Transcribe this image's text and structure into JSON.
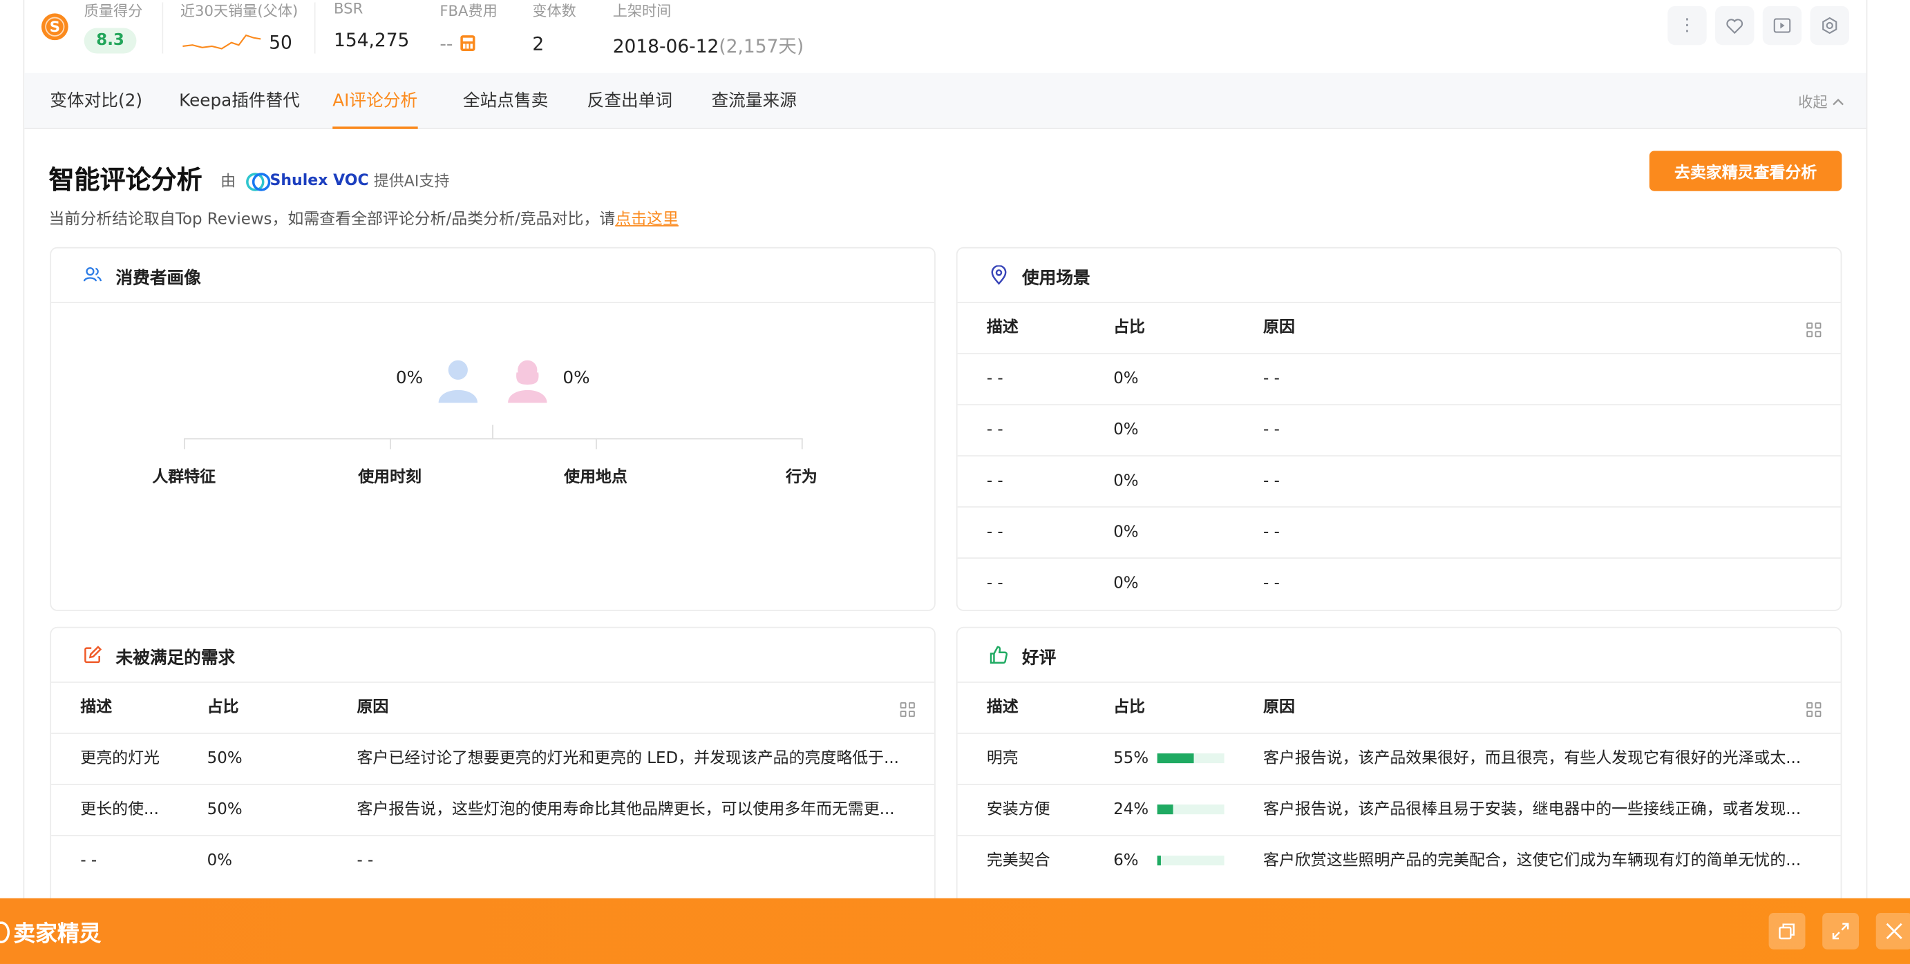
{
  "stats": {
    "quality_label": "质量得分",
    "quality_value": "8.3",
    "sales_label": "近30天销量(父体)",
    "sales_value": "50",
    "bsr_label": "BSR",
    "bsr_value": "154,275",
    "fba_label": "FBA费用",
    "fba_value": "--",
    "variants_label": "变体数",
    "variants_value": "2",
    "listed_label": "上架时间",
    "listed_date": "2018-06-12",
    "listed_days": "(2,157天)"
  },
  "toolbar_icons": [
    "more-vertical-icon",
    "heart-icon",
    "play-icon",
    "gear-icon"
  ],
  "tabs": [
    {
      "label": "变体对比(2)"
    },
    {
      "label": "Keepa插件替代"
    },
    {
      "label": "AI评论分析"
    },
    {
      "label": "全站点售卖"
    },
    {
      "label": "反查出单词"
    },
    {
      "label": "查流量来源"
    }
  ],
  "collapse_label": "收起",
  "header": {
    "title": "智能评论分析",
    "by": "由",
    "provider": "Shulex VOC",
    "support": "提供AI支持",
    "subtitle": "当前分析结论取自Top Reviews，如需查看全部评论分析/品类分析/竞品对比，请",
    "subtitle_link": "点击这里",
    "cta": "去卖家精灵查看分析"
  },
  "consumer": {
    "title": "消费者画像",
    "male_pct": "0%",
    "female_pct": "0%",
    "branches": [
      "人群特征",
      "使用时刻",
      "使用地点",
      "行为"
    ]
  },
  "scenarios": {
    "title": "使用场景",
    "columns": [
      "描述",
      "占比",
      "原因"
    ],
    "rows": [
      {
        "desc": "- -",
        "pct": "0%",
        "reason": "- -"
      },
      {
        "desc": "- -",
        "pct": "0%",
        "reason": "- -"
      },
      {
        "desc": "- -",
        "pct": "0%",
        "reason": "- -"
      },
      {
        "desc": "- -",
        "pct": "0%",
        "reason": "- -"
      },
      {
        "desc": "- -",
        "pct": "0%",
        "reason": "- -"
      }
    ]
  },
  "unmet": {
    "title": "未被满足的需求",
    "columns": [
      "描述",
      "占比",
      "原因"
    ],
    "rows": [
      {
        "desc": "更亮的灯光",
        "pct": "50%",
        "reason": "客户已经讨论了想要更亮的灯光和更亮的 LED，并发现该产品的亮度略低于..."
      },
      {
        "desc": "更长的使...",
        "pct": "50%",
        "reason": "客户报告说，这些灯泡的使用寿命比其他品牌更长，可以使用多年而无需更..."
      },
      {
        "desc": "- -",
        "pct": "0%",
        "reason": "- -"
      }
    ]
  },
  "positive": {
    "title": "好评",
    "columns": [
      "描述",
      "占比",
      "原因"
    ],
    "rows": [
      {
        "desc": "明亮",
        "pct": "55%",
        "ratio": 0.55,
        "reason": "客户报告说，该产品效果很好，而且很亮，有些人发现它有很好的光泽或太..."
      },
      {
        "desc": "安装方便",
        "pct": "24%",
        "ratio": 0.24,
        "reason": "客户报告说，该产品很棒且易于安装，继电器中的一些接线正确，或者发现..."
      },
      {
        "desc": "完美契合",
        "pct": "6%",
        "ratio": 0.06,
        "reason": "客户欣赏这些照明产品的完美配合，这使它们成为车辆现有灯的简单无忧的..."
      }
    ]
  },
  "footer": {
    "brand": "卖家精灵"
  },
  "colors": {
    "accent": "#fb8a1d",
    "positive_bar": "#1faa62",
    "score_green": "#22a55a",
    "link_blue": "#1c3fbf"
  }
}
